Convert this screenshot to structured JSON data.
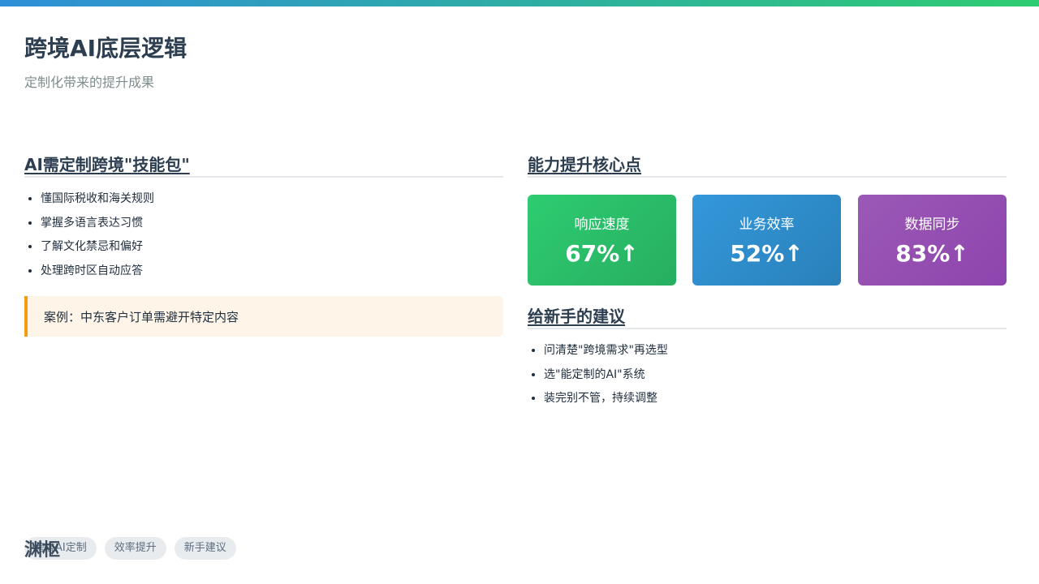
{
  "header": {
    "title": "跨境AI底层逻辑",
    "subtitle": "定制化带来的提升成果"
  },
  "left": {
    "section_title": "AI需定制跨境\"技能包\"",
    "items": [
      "懂国际税收和海关规则",
      "掌握多语言表达习惯",
      "了解文化禁忌和偏好",
      "处理跨时区自动应答"
    ],
    "case": "案例：中东客户订单需避开特定内容"
  },
  "right": {
    "metrics_title": "能力提升核心点",
    "metrics": [
      {
        "label": "响应速度",
        "value": "67%↑",
        "color": "#2ecc71"
      },
      {
        "label": "业务效率",
        "value": "52%↑",
        "color": "#3498db"
      },
      {
        "label": "数据同步",
        "value": "83%↑",
        "color": "#9b59b6"
      }
    ],
    "advice_title": "给新手的建议",
    "advice": [
      "问清楚\"跨境需求\"再选型",
      "选\"能定制的AI\"系统",
      "装完别不管，持续调整"
    ]
  },
  "footer": {
    "tags": [
      "跨境AI定制",
      "效率提升",
      "新手建议"
    ],
    "logo": "渊枢"
  }
}
